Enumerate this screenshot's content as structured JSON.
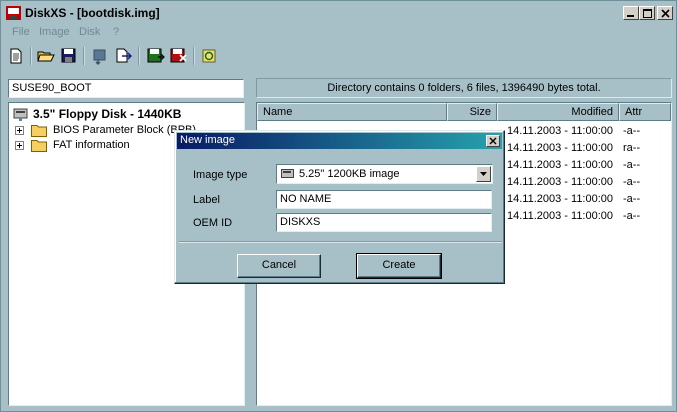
{
  "app": {
    "title": "DiskXS - [bootdisk.img]"
  },
  "menu": [
    "File",
    "Image",
    "Disk",
    "?"
  ],
  "toolbar": {
    "icons": [
      "new-image-icon",
      "open-icon",
      "save-icon",
      "import-icon",
      "export-icon",
      "write-disk-icon",
      "read-disk-icon",
      "about-icon"
    ]
  },
  "volume": {
    "label": "SUSE90_BOOT"
  },
  "status": {
    "text": "Directory contains 0 folders, 6 files, 1396490 bytes total."
  },
  "tree": {
    "root": "3.5\" Floppy Disk - 1440KB",
    "nodes": [
      "BIOS Parameter Block (BPB)",
      "FAT information"
    ]
  },
  "list": {
    "columns": [
      "Name",
      "Size",
      "Modified",
      "Attr"
    ],
    "rows": [
      {
        "modified": "14.11.2003 - 11:00:00",
        "attr": "-a--"
      },
      {
        "modified": "14.11.2003 - 11:00:00",
        "attr": "ra--"
      },
      {
        "modified": "14.11.2003 - 11:00:00",
        "attr": "-a--"
      },
      {
        "modified": "14.11.2003 - 11:00:00",
        "attr": "-a--"
      },
      {
        "modified": "14.11.2003 - 11:00:00",
        "attr": "-a--"
      },
      {
        "modified": "14.11.2003 - 11:00:00",
        "attr": "-a--"
      }
    ]
  },
  "dialog": {
    "title": "New image",
    "image_type_label": "Image type",
    "image_type_value": "5.25\" 1200KB image",
    "label_label": "Label",
    "label_value": "NO NAME",
    "oem_label": "OEM ID",
    "oem_value": "DISKXS",
    "cancel": "Cancel",
    "create": "Create"
  },
  "colors": {
    "accent": "#081a64",
    "accent_end": "#27a2ad",
    "background": "#a7c0c8"
  }
}
